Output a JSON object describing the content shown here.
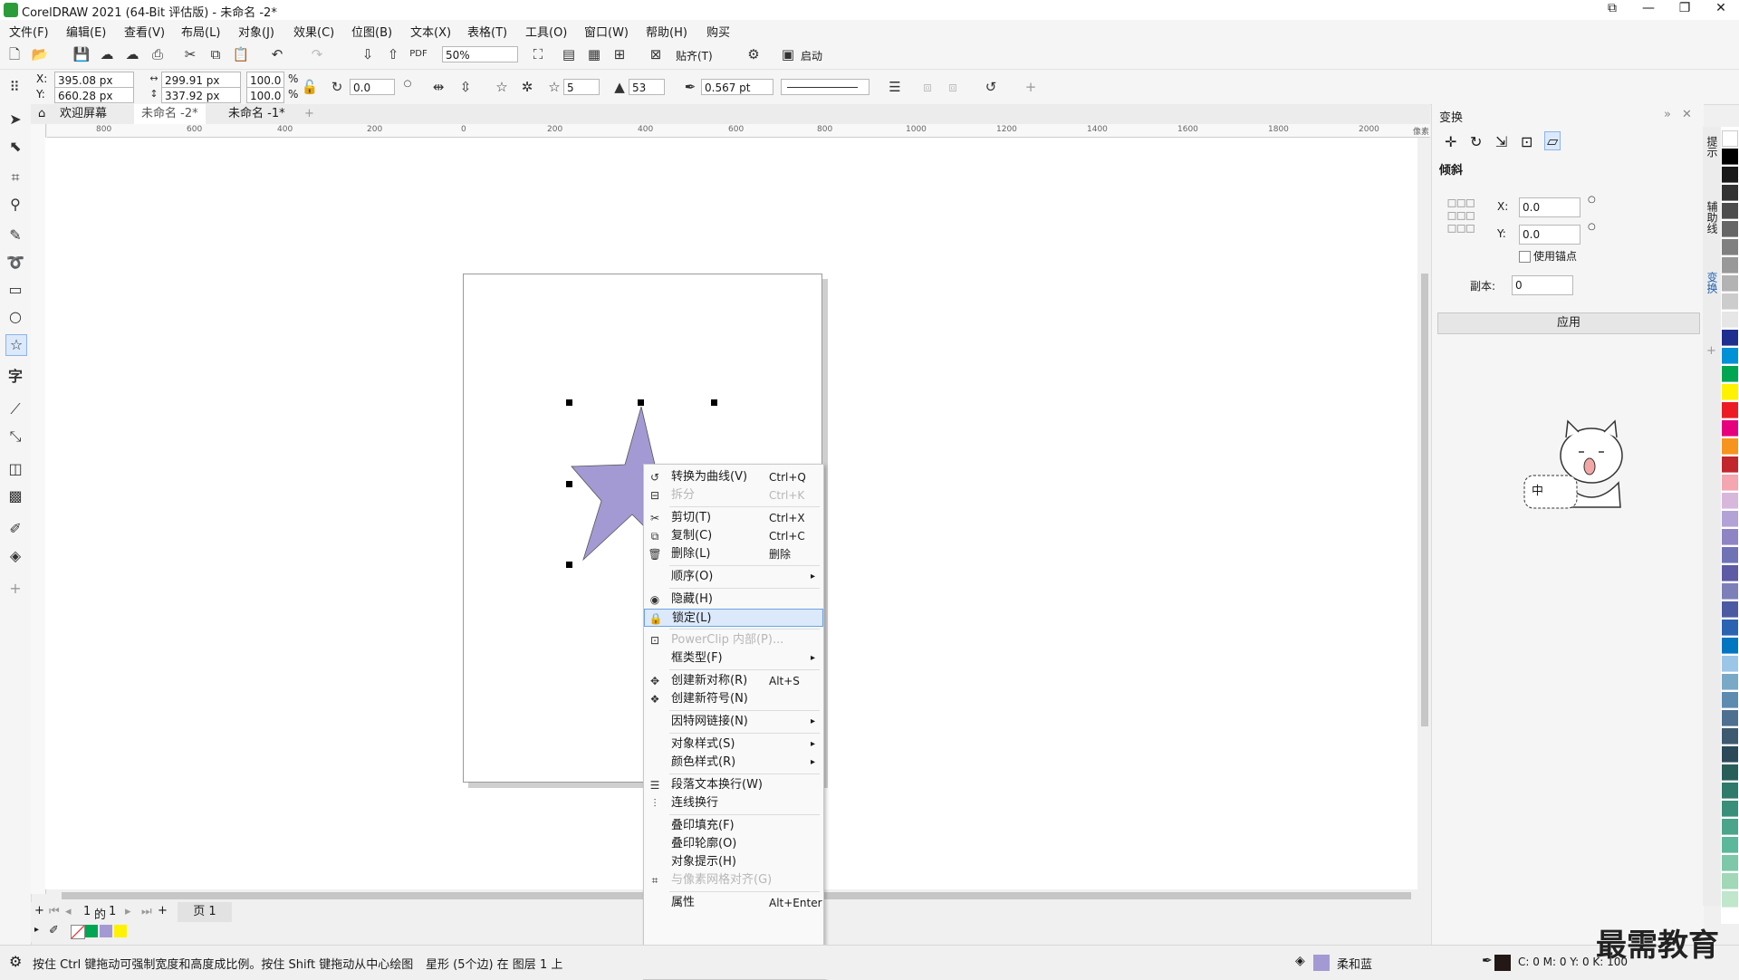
{
  "window": {
    "title": "CorelDRAW 2021 (64-Bit 评估版) - 未命名 -2*"
  },
  "menu": [
    "文件(F)",
    "编辑(E)",
    "查看(V)",
    "布局(L)",
    "对象(J)",
    "效果(C)",
    "位图(B)",
    "文本(X)",
    "表格(T)",
    "工具(O)",
    "窗口(W)",
    "帮助(H)",
    "购买"
  ],
  "toolbar1": {
    "zoom": "50%",
    "snap_label": "贴齐(T)",
    "launch_label": "启动"
  },
  "property_bar": {
    "x_label": "X:",
    "x": "395.08 px",
    "y_label": "Y:",
    "y": "660.28 px",
    "width": "299.91 px",
    "height": "337.92 px",
    "scale_w": "100.0",
    "scale_h": "100.0",
    "pct": "%",
    "angle": "0.0",
    "points": "5",
    "sharpness": "53",
    "outline": "0.567 pt"
  },
  "tabs": {
    "welcome": "欢迎屏幕",
    "doc2": "未命名 -2*",
    "doc1": "未命名 -1*"
  },
  "ruler": {
    "h": [
      "800",
      "600",
      "400",
      "200",
      "0",
      "200",
      "400",
      "600",
      "800",
      "1000",
      "1200",
      "1400",
      "1600",
      "1800",
      "2000"
    ],
    "unit": "像素"
  },
  "star": {
    "fill": "#a39ad4"
  },
  "page_nav": {
    "current": "1",
    "of": "的",
    "total": "1",
    "page_tab": "页 1"
  },
  "context_menu": [
    {
      "label": "转换为曲线(V)",
      "shortcut": "Ctrl+Q",
      "icon": "convert-curve-icon",
      "state": "normal"
    },
    {
      "label": "拆分",
      "shortcut": "Ctrl+K",
      "icon": "break-apart-icon",
      "state": "disabled"
    },
    {
      "label": "剪切(T)",
      "shortcut": "Ctrl+X",
      "icon": "cut-icon",
      "state": "normal"
    },
    {
      "label": "复制(C)",
      "shortcut": "Ctrl+C",
      "icon": "copy-icon",
      "state": "normal"
    },
    {
      "label": "删除(L)",
      "shortcut": "删除",
      "icon": "delete-icon",
      "state": "normal"
    },
    {
      "label": "顺序(O)",
      "shortcut": "",
      "icon": "",
      "state": "submenu"
    },
    {
      "label": "隐藏(H)",
      "shortcut": "",
      "icon": "eye-icon",
      "state": "normal"
    },
    {
      "label": "锁定(L)",
      "shortcut": "",
      "icon": "lock-icon",
      "state": "highlighted"
    },
    {
      "label": "PowerClip 内部(P)...",
      "shortcut": "",
      "icon": "powerclip-icon",
      "state": "disabled"
    },
    {
      "label": "框类型(F)",
      "shortcut": "",
      "icon": "",
      "state": "submenu"
    },
    {
      "label": "创建新对称(R)",
      "shortcut": "Alt+S",
      "icon": "symmetry-icon",
      "state": "normal"
    },
    {
      "label": "创建新符号(N)",
      "shortcut": "",
      "icon": "symbol-icon",
      "state": "normal"
    },
    {
      "label": "因特网链接(N)",
      "shortcut": "",
      "icon": "",
      "state": "submenu"
    },
    {
      "label": "对象样式(S)",
      "shortcut": "",
      "icon": "",
      "state": "submenu"
    },
    {
      "label": "颜色样式(R)",
      "shortcut": "",
      "icon": "",
      "state": "submenu"
    },
    {
      "label": "段落文本换行(W)",
      "shortcut": "",
      "icon": "text-wrap-icon",
      "state": "normal"
    },
    {
      "label": "连线换行",
      "shortcut": "",
      "icon": "line-wrap-icon",
      "state": "normal"
    },
    {
      "label": "叠印填充(F)",
      "shortcut": "",
      "icon": "",
      "state": "normal"
    },
    {
      "label": "叠印轮廓(O)",
      "shortcut": "",
      "icon": "",
      "state": "normal"
    },
    {
      "label": "对象提示(H)",
      "shortcut": "",
      "icon": "",
      "state": "normal"
    },
    {
      "label": "与像素网格对齐(G)",
      "shortcut": "",
      "icon": "pixel-grid-icon",
      "state": "disabled"
    },
    {
      "label": "属性",
      "shortcut": "Alt+Enter",
      "icon": "",
      "state": "normal"
    }
  ],
  "docker": {
    "title": "变换",
    "section": "倾斜",
    "x_label": "X:",
    "x": "0.0",
    "y_label": "Y:",
    "y": "0.0",
    "anchor_label": "使用锚点",
    "copies_label": "副本:",
    "copies": "0",
    "apply": "应用",
    "ime": "中"
  },
  "side_tabs": [
    "提示",
    "辅助线",
    "变换"
  ],
  "status": {
    "hint": "按住 Ctrl 键拖动可强制宽度和高度成比例。按住 Shift 键拖动从中心绘图",
    "object": "星形 (5个边) 在 图层 1 上",
    "fill_name": "柔和蓝",
    "outline_cmyk": "C: 0 M: 0 Y: 0 K: 100"
  },
  "watermark": "最需教育",
  "colors": {
    "palette": [
      "#ffffff",
      "#000000",
      "#1a1a1a",
      "#333333",
      "#4d4d4d",
      "#666666",
      "#808080",
      "#999999",
      "#b3b3b3",
      "#cccccc",
      "#e6e6e6",
      "#1f2f8f",
      "#0091d6",
      "#00a651",
      "#fff200",
      "#ed1c24",
      "#e6007e",
      "#f7941d",
      "#c1272d",
      "#f4a6b1",
      "#d8b7dd",
      "#b3a2d6",
      "#8f84c4",
      "#6f73b6",
      "#5e5aa5",
      "#7d7fb8",
      "#4b5aa2",
      "#2a63b2",
      "#0077c0",
      "#9cc6e8",
      "#7aa9c7",
      "#5e8bb0",
      "#4d7090",
      "#3d5a70",
      "#2a4a5a",
      "#285e5a",
      "#2f7a6a",
      "#3a8f7a",
      "#4aa58a",
      "#5cb89a",
      "#7cc8a8",
      "#a0d8b8",
      "#c0e6cc"
    ]
  }
}
